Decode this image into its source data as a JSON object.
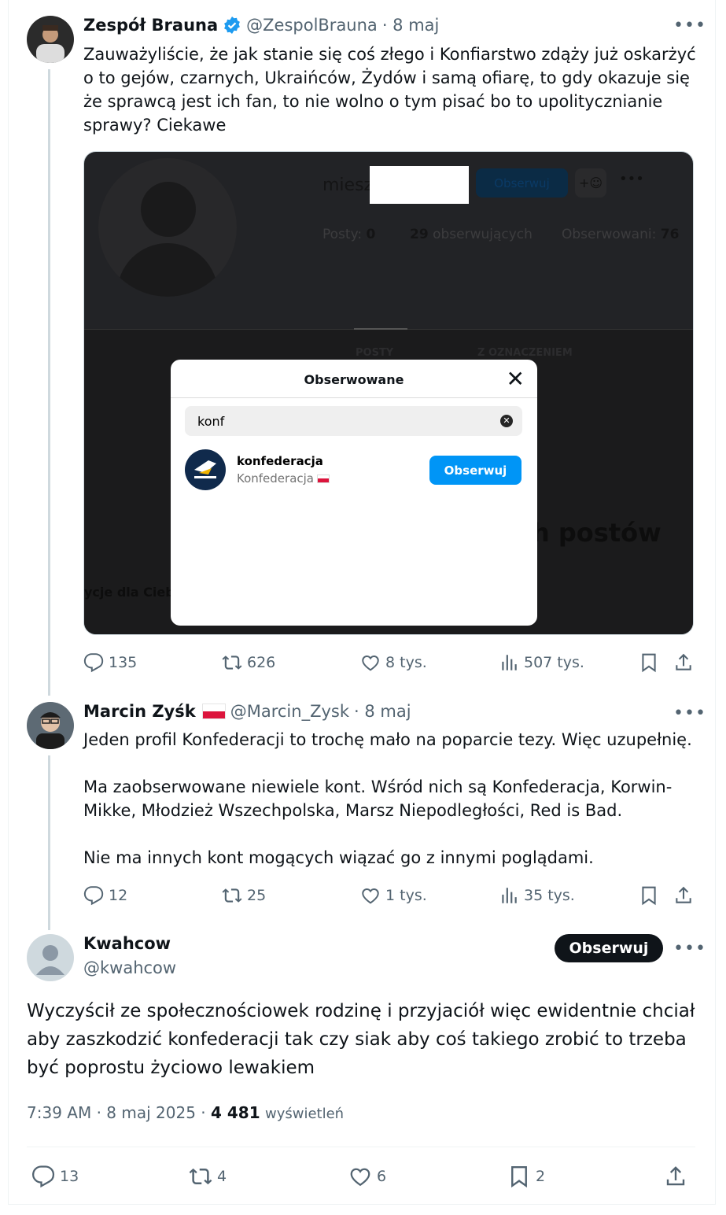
{
  "tweet1": {
    "author": "Zespół Brauna",
    "handle": "@ZespolBrauna",
    "date": "· 8 maj",
    "text": "Zauważyliście, że jak stanie się coś złego i Konfiarstwo zdąży już oskarżyć o to gejów, czarnych, Ukraińców, Żydów i samą ofiarę, to gdy okazuje się że sprawcą jest ich fan, to nie wolno o tym pisać bo to upolitycznianie sprawy? Ciekawe",
    "replies": "135",
    "reposts": "626",
    "likes": "8 tys.",
    "views": "507 tys."
  },
  "embedded": {
    "username_prefix": "miesz",
    "follow": "Obserwuj",
    "posts_label": "Posty:",
    "posts_count": "0",
    "followers_count": "29",
    "followers_label": "obserwujących",
    "following_label": "Obserwowani:",
    "following_count": "76",
    "tab_posts": "POSTY",
    "tab_tagged": "Z OZNACZENIEM",
    "no_posts": "ch postów",
    "suggestions": "ycje dla Ciebi",
    "modal_title": "Obserwowane",
    "search_value": "konf",
    "result_username": "konfederacja",
    "result_name": "Konfederacja",
    "result_follow": "Obserwuj"
  },
  "tweet2": {
    "author": "Marcin Zyśk",
    "handle": "@Marcin_Zysk",
    "date": "· 8 maj",
    "p1": "Jeden profil Konfederacji to trochę mało na poparcie tezy. Więc uzupełnię.",
    "p2": "Ma zaobserwowane niewiele kont. Wśród nich są Konfederacja, Korwin-Mikke, Młodzież Wszechpolska, Marsz Niepodległości, Red is Bad.",
    "p3": "Nie ma innych kont mogących wiązać go z innymi poglądami.",
    "replies": "12",
    "reposts": "25",
    "likes": "1 tys.",
    "views": "35 tys."
  },
  "tweet3": {
    "author": "Kwahcow",
    "handle": "@kwahcow",
    "follow": "Obserwuj",
    "text": "Wyczyścił ze społecznościowek rodzinę i przyjaciół więc ewidentnie chciał aby zaszkodzić konfederacji tak czy siak aby coś takiego zrobić to trzeba być poprostu życiowo lewakiem",
    "time": "7:39 AM · 8 maj 2025 ·",
    "views_count": "4 481",
    "views_label": "wyświetleń",
    "replies": "13",
    "reposts": "4",
    "likes": "6",
    "bookmarks": "2"
  },
  "colors": {
    "verified": "#1d9bf0",
    "text": "#0f1419",
    "muted": "#536471",
    "ig_blue": "#0095f6"
  }
}
